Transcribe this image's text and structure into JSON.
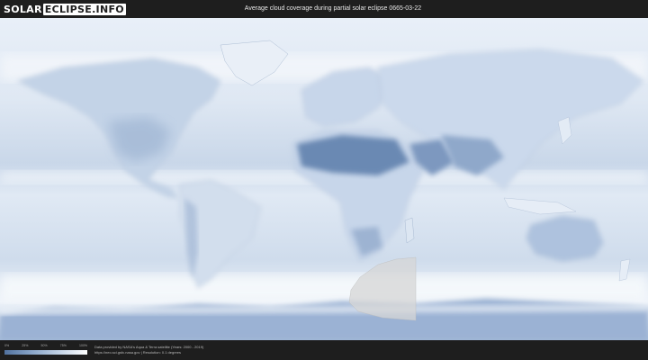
{
  "header": {
    "logo_solar": "SOLAR",
    "logo_eclipse": "ECLIPSE.INFO",
    "title": "Average cloud coverage during partial solar eclipse 0665-03-22"
  },
  "legend": {
    "ticks": [
      "0%",
      "25%",
      "50%",
      "75%",
      "100%"
    ],
    "colors": [
      "#51729f",
      "#8aa6c9",
      "#c4d4e7",
      "#ffffff"
    ]
  },
  "credits": {
    "line1": "Data provided by NASA's Aqua & Terra satellite (Years: 2000 - 2019)",
    "line2": "https://neo.sci.gsfc.nasa.gov | Resolution: 0.1 degrees"
  },
  "colors": {
    "background": "#1e1e1e",
    "clear_sky": "#5c7aa6",
    "cloud": "#ffffff",
    "eclipse_zone": "#d6d6d6"
  }
}
